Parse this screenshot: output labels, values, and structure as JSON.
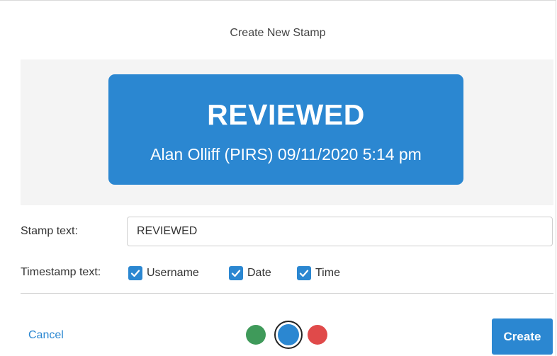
{
  "dialog": {
    "title": "Create New Stamp"
  },
  "preview": {
    "main_text": "REVIEWED",
    "sub_text": "Alan Olliff (PIRS) 09/11/2020 5:14 pm",
    "background_color": "#2b87d1"
  },
  "form": {
    "stamp_text_label": "Stamp text:",
    "stamp_text_value": "REVIEWED",
    "timestamp_label": "Timestamp text:",
    "options": [
      {
        "label": "Username",
        "checked": true
      },
      {
        "label": "Date",
        "checked": true
      },
      {
        "label": "Time",
        "checked": true
      }
    ]
  },
  "colors": {
    "options": [
      {
        "name": "green",
        "hex": "#3f9a5a"
      },
      {
        "name": "blue",
        "hex": "#2b87d1",
        "selected": true
      },
      {
        "name": "red",
        "hex": "#e04a4a"
      }
    ],
    "checkbox": "#2b87d1",
    "link": "#2b87d1",
    "primary": "#2b87d1"
  },
  "actions": {
    "cancel_label": "Cancel",
    "create_label": "Create"
  },
  "icons": {
    "checkbox_check": "check-icon"
  }
}
